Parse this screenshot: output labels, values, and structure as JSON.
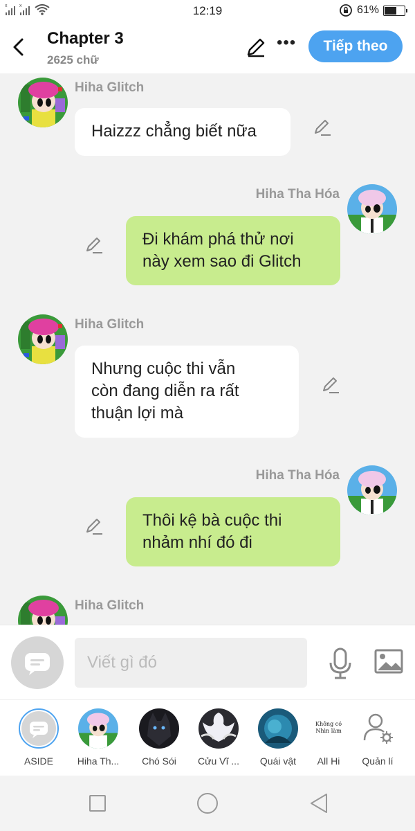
{
  "status": {
    "time": "12:19",
    "battery": "61%",
    "battery_level": 0.61
  },
  "header": {
    "title": "Chapter 3",
    "subtitle": "2625 chữ",
    "next_label": "Tiếp theo"
  },
  "messages": [
    {
      "side": "left",
      "name": "Hiha Glitch",
      "text": "Haizzz chẳng biết nữa"
    },
    {
      "side": "right",
      "name": "Hiha Tha Hóa",
      "lines": [
        "Đi khám phá thử nơi",
        "này xem sao đi Glitch"
      ]
    },
    {
      "side": "left",
      "name": "Hiha Glitch",
      "lines": [
        "Nhưng cuộc thi vẫn",
        "còn đang diễn ra rất",
        "thuận lợi mà"
      ]
    },
    {
      "side": "right",
      "name": "Hiha Tha Hóa",
      "lines": [
        "Thôi kệ bà cuộc thi",
        "nhảm nhí đó đi"
      ]
    },
    {
      "side": "left",
      "name": "Hiha Glitch"
    }
  ],
  "input": {
    "placeholder": "Viết gì đó"
  },
  "characters": [
    {
      "label": "ASIDE"
    },
    {
      "label": "Hiha Th..."
    },
    {
      "label": "Chó Sói"
    },
    {
      "label": "Cửu Vĩ ..."
    },
    {
      "label": "Quái vật"
    },
    {
      "label": "All Hi",
      "avatar_text": [
        "Không có",
        "Nhìn làm"
      ]
    },
    {
      "label": "Quản lí"
    }
  ]
}
